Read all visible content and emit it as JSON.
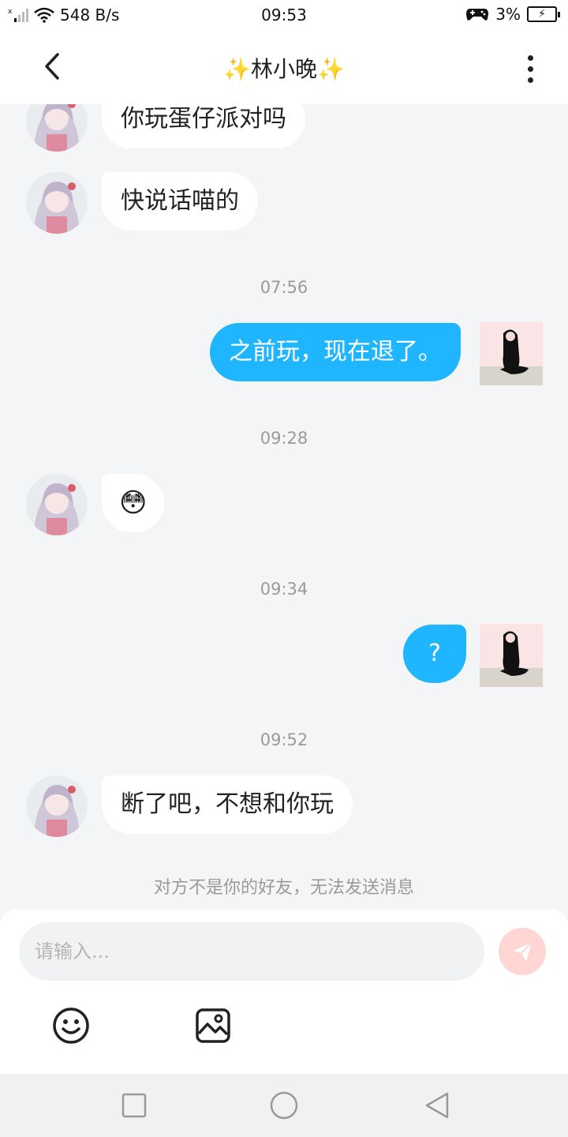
{
  "status_bar": {
    "net_speed": "548 B/s",
    "time": "09:53",
    "battery": "3%"
  },
  "header": {
    "title": "✨林小晚✨"
  },
  "messages": [
    {
      "side": "left",
      "text": "你玩蛋仔派对吗"
    },
    {
      "side": "left",
      "text": "快说话喵的"
    },
    {
      "side": "right",
      "text": "之前玩，现在退了。"
    },
    {
      "side": "left",
      "text": "😳"
    },
    {
      "side": "right",
      "text": "?"
    },
    {
      "side": "left",
      "text": "断了吧，不想和你玩"
    }
  ],
  "timestamps": [
    "07:56",
    "09:28",
    "09:34",
    "09:52"
  ],
  "notice": "对方不是你的好友，无法发送消息",
  "input": {
    "placeholder": "请输入..."
  },
  "icons": {
    "back": "chevron-left-icon",
    "more": "more-vertical-icon",
    "send": "send-icon",
    "emoji": "emoji-icon",
    "image": "image-icon"
  },
  "colors": {
    "accent": "#1fb6ff",
    "send_disabled": "#ffd6d3",
    "background": "#f4f5f7"
  }
}
